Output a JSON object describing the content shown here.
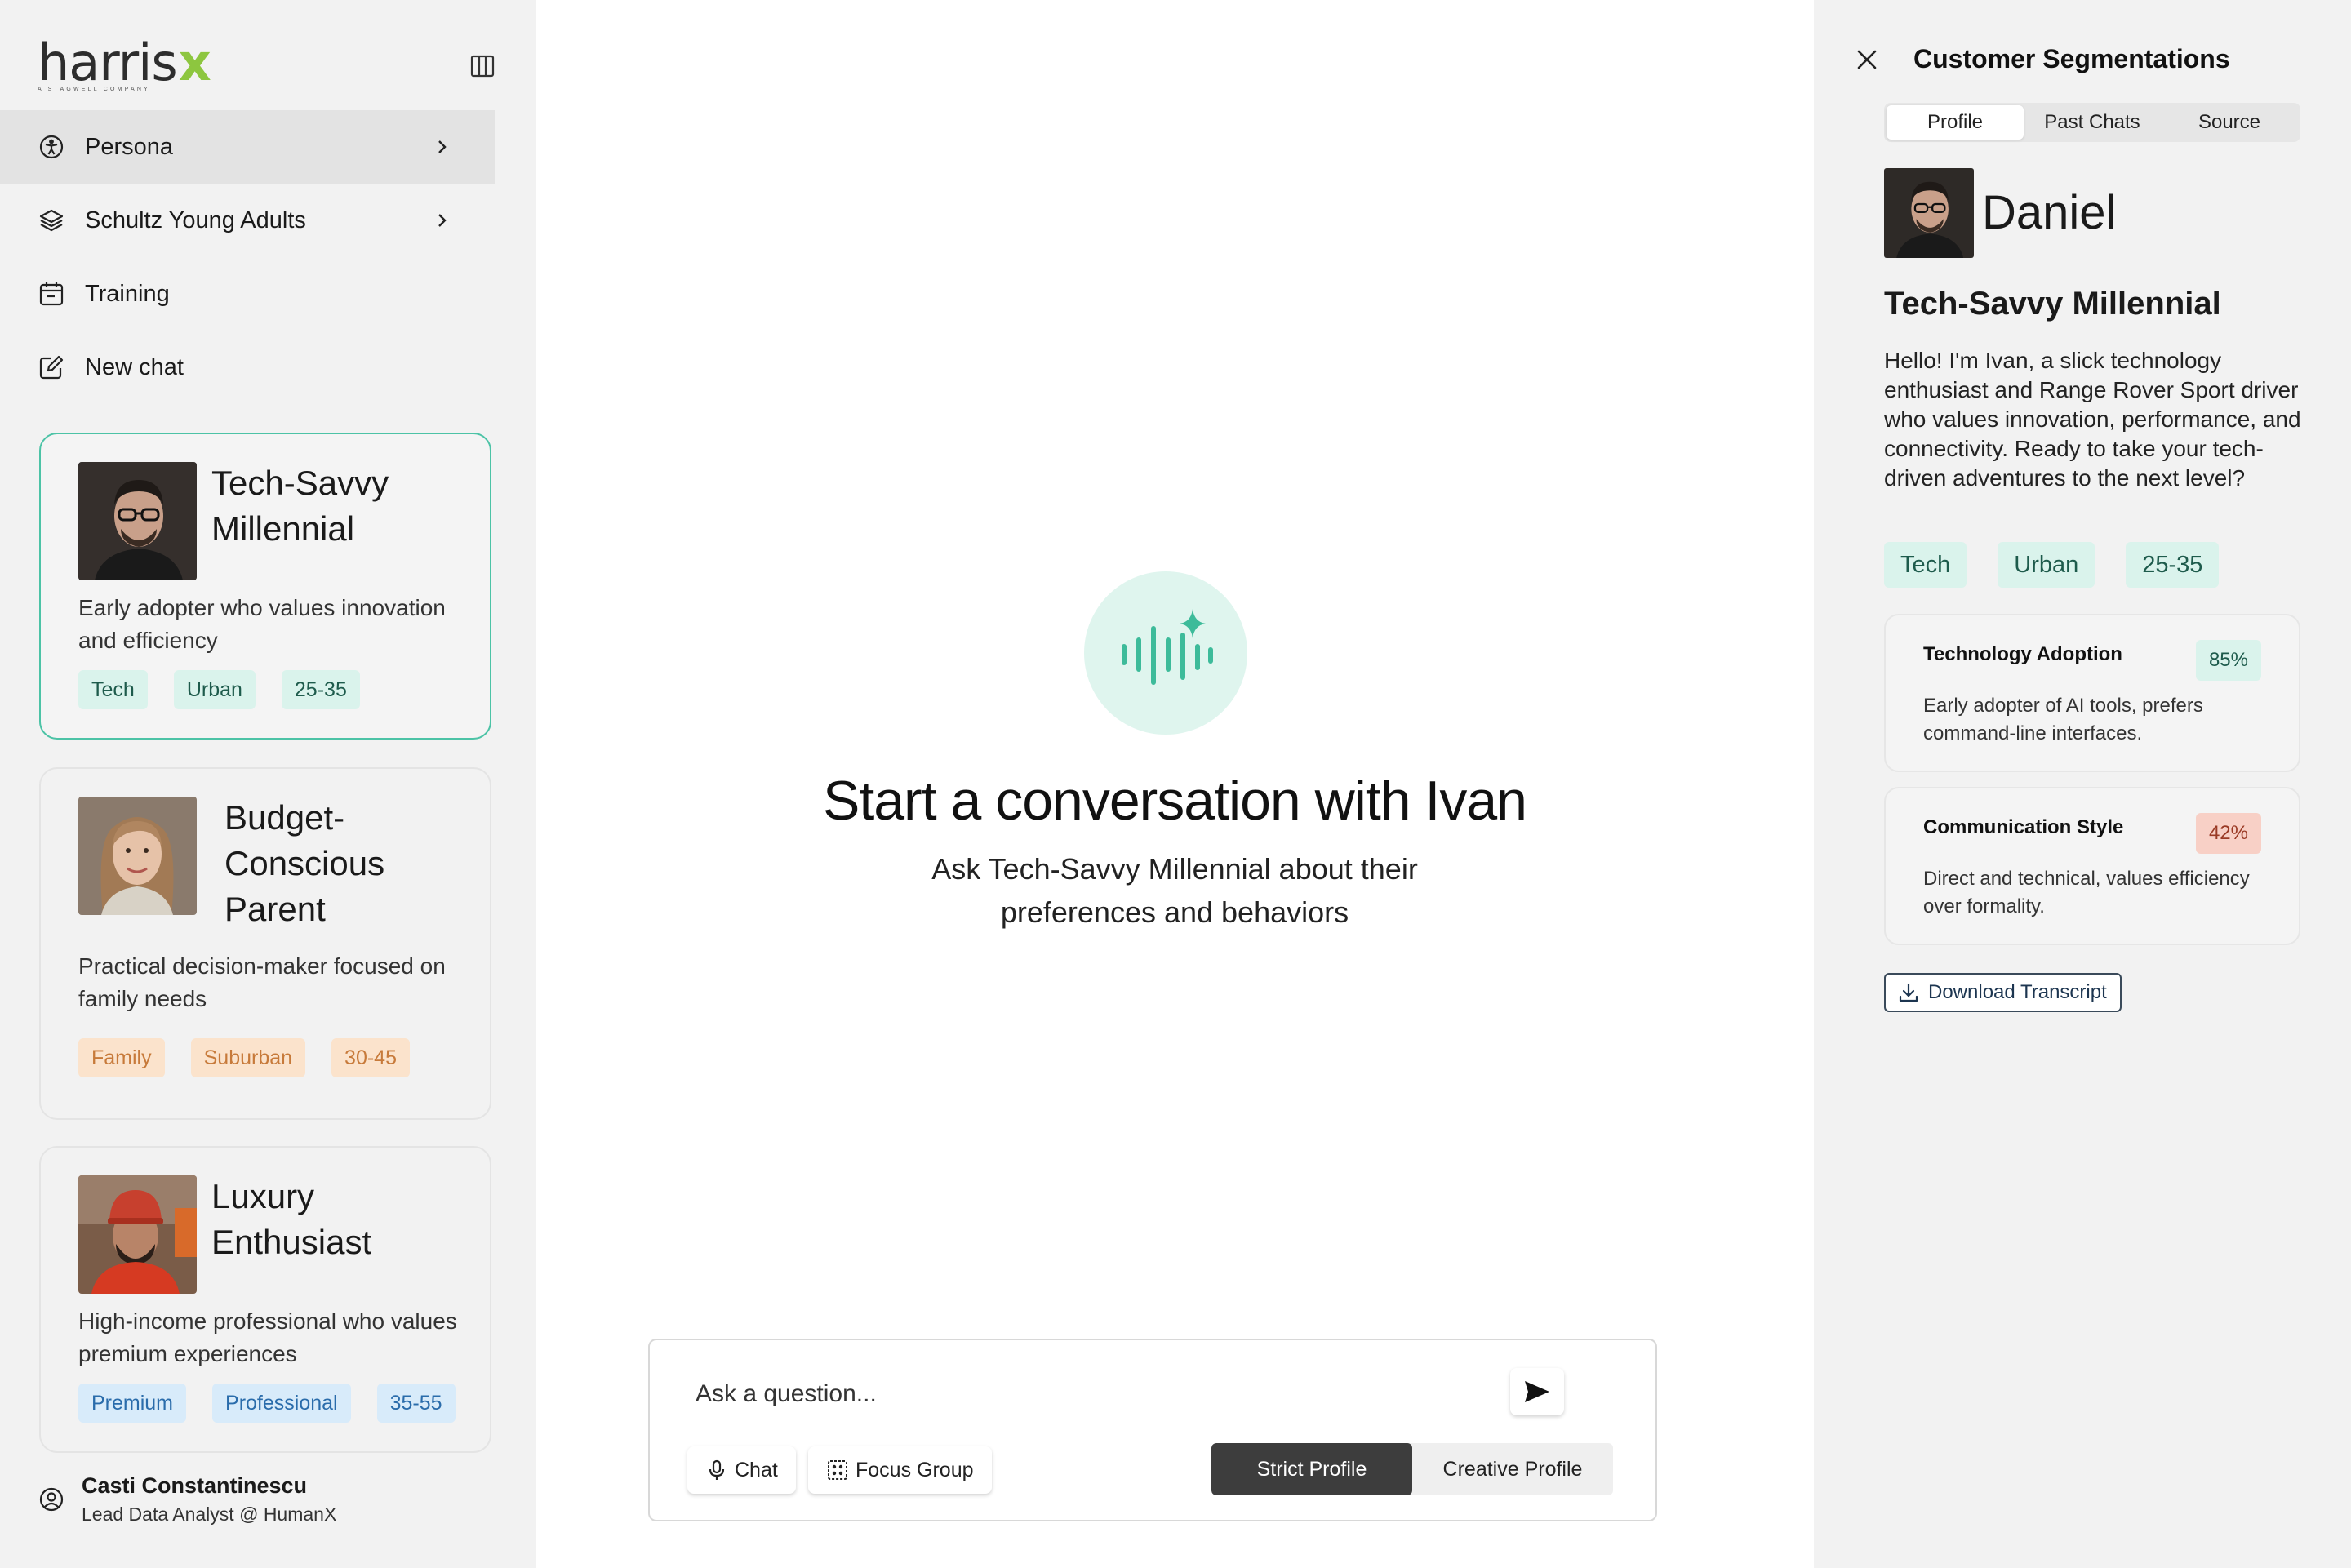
{
  "brand": {
    "name_main": "harris",
    "name_x": "x",
    "tagline": "A STAGWELL COMPANY"
  },
  "sidebar": {
    "nav": [
      {
        "label": "Persona",
        "icon": "accessibility-icon",
        "active": true,
        "has_chevron": true
      },
      {
        "label": "Schultz Young Adults",
        "icon": "layers-icon",
        "active": false,
        "has_chevron": true
      },
      {
        "label": "Training",
        "icon": "calendar-icon",
        "active": false,
        "has_chevron": false
      },
      {
        "label": "New chat",
        "icon": "edit-icon",
        "active": false,
        "has_chevron": false
      }
    ],
    "personas": [
      {
        "title_l1": "Tech-Savvy",
        "title_l2": "Millennial",
        "title_l3": "",
        "description": "Early adopter who values innovation and efficiency",
        "tags": [
          "Tech",
          "Urban",
          "25-35"
        ],
        "tag_color": "green",
        "selected": true
      },
      {
        "title_l1": "Budget-",
        "title_l2": "Conscious",
        "title_l3": "Parent",
        "description": "Practical decision-maker focused on family needs",
        "tags": [
          "Family",
          "Suburban",
          "30-45"
        ],
        "tag_color": "orange",
        "selected": false
      },
      {
        "title_l1": "Luxury",
        "title_l2": "Enthusiast",
        "title_l3": "",
        "description": "High-income professional who values premium experiences",
        "tags": [
          "Premium",
          "Professional",
          "35-55"
        ],
        "tag_color": "blue",
        "selected": false
      }
    ],
    "user": {
      "name": "Casti Constantinescu",
      "role": "Lead Data Analyst @ HumanX"
    }
  },
  "main": {
    "title": "Start a conversation with Ivan",
    "subtitle": "Ask Tech-Savvy Millennial about their preferences and behaviors",
    "composer": {
      "placeholder": "Ask a question...",
      "chat_label": "Chat",
      "focus_group_label": "Focus Group",
      "modes": [
        "Strict Profile",
        "Creative Profile"
      ],
      "active_mode": "Strict Profile"
    }
  },
  "panel": {
    "title": "Customer Segmentations",
    "tabs": [
      "Profile",
      "Past Chats",
      "Source"
    ],
    "active_tab": "Profile",
    "name": "Daniel",
    "persona": "Tech-Savvy Millennial",
    "bio": "Hello! I'm Ivan, a slick technology enthusiast and Range Rover Sport driver who values innovation, performance, and connectivity. Ready to take your tech-driven adventures to the next level?",
    "tags": [
      "Tech",
      "Urban",
      "25-35"
    ],
    "metrics": [
      {
        "label": "Technology Adoption",
        "value": "85%",
        "color": "#daf3ec",
        "description": "Early adopter of AI tools, prefers command-line interfaces."
      },
      {
        "label": "Communication Style",
        "value": "42%",
        "color": "#f8d0c6",
        "description": "Direct and technical, values efficiency over formality."
      }
    ],
    "download_label": "Download Transcript"
  },
  "colors": {
    "accent": "#4cc3a6",
    "dark_button": "#3d3d3d",
    "sidebar_bg": "#f2f2f2"
  }
}
